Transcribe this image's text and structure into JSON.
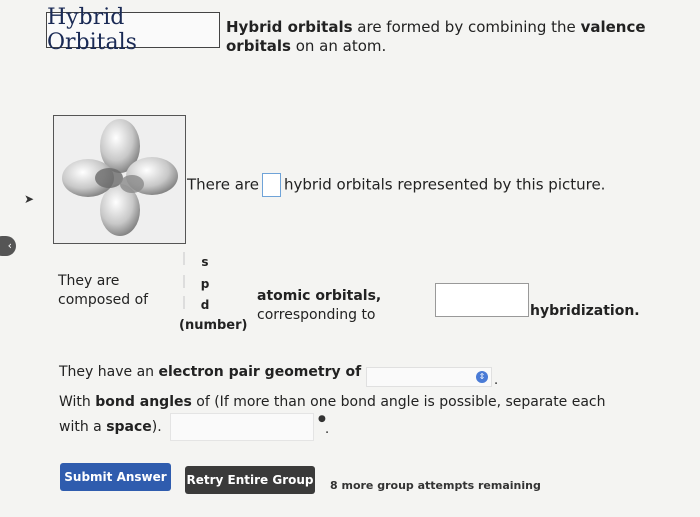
{
  "title": "Hybrid Orbitals",
  "intro": {
    "t1": "Hybrid orbitals",
    "t2": " are formed by combining the ",
    "t3": "valence orbitals",
    "t4": " on an atom."
  },
  "q1": {
    "before": "There are",
    "after": "hybrid orbitals represented by this picture."
  },
  "composed": {
    "line1": "They are",
    "line2": "composed of"
  },
  "spd": {
    "s": "s",
    "p": "p",
    "d": "d",
    "number": "(number)"
  },
  "atomic": {
    "label": "atomic orbitals,",
    "corr": "corresponding to"
  },
  "hybridization_label": "hybridization.",
  "geometry": {
    "prefix": "They have an ",
    "bold": "electron pair geometry of",
    "suffix": "."
  },
  "bond": {
    "t1": "With ",
    "t2": "bond angles",
    "t3": " of (If more than one bond angle is possible, separate each with a ",
    "t4": "space",
    "t5": ").",
    "end": "."
  },
  "buttons": {
    "submit": "Submit Answer",
    "retry": "Retry Entire Group"
  },
  "attempts": "8 more group attempts remaining",
  "colors": {
    "submit": "#2f5cae",
    "retry": "#3a3a3a",
    "input_border": "#6fa3d8"
  }
}
